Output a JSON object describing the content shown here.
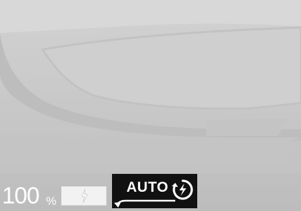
{
  "battery": {
    "percent_value": "100",
    "percent_unit": "%",
    "level_fraction": 1.0
  },
  "charging_mode": {
    "label": "AUTO",
    "icon": "auto-charge-cycle-icon"
  },
  "icons": {
    "battery_bolt": "lightning-bolt-icon"
  },
  "colors": {
    "text": "#ffffff",
    "panel_background": "#111111",
    "gauge_fill": "#f2f2f2",
    "background": "#c9c9c9"
  }
}
